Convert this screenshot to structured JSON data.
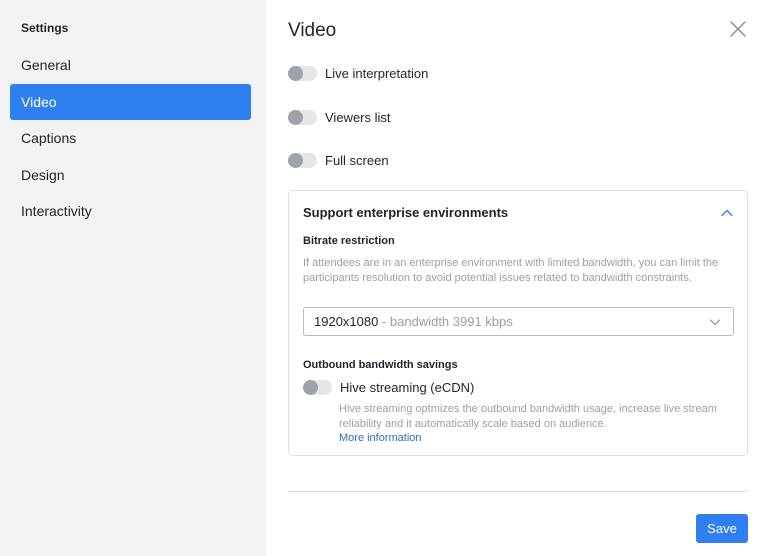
{
  "sidebar": {
    "title": "Settings",
    "items": [
      {
        "label": "General"
      },
      {
        "label": "Video"
      },
      {
        "label": "Captions"
      },
      {
        "label": "Design"
      },
      {
        "label": "Interactivity"
      }
    ],
    "active_item": "Video"
  },
  "main": {
    "title": "Video",
    "toggles": [
      {
        "label": "Live interpretation",
        "on": false
      },
      {
        "label": "Viewers list",
        "on": false
      },
      {
        "label": "Full screen",
        "on": false
      }
    ],
    "panel": {
      "title": "Support enterprise environments",
      "expanded": true,
      "bitrate": {
        "label": "Bitrate restriction",
        "help": "If attendees are in an enterprise environment with limited bandwidth, you can limit the participants resolution to avoid potential issues related to bandwidth constraints.",
        "selected_value": "1920x1080",
        "selected_sub": " - bandwidth 3991 kbps"
      },
      "outbound": {
        "label": "Outbound bandwidth savings",
        "toggle_label": "Hive streaming (eCDN)",
        "toggle_on": false,
        "help": "Hive streaming optmizes the outbound bandwidth usage, increase live stream reliability and it automatically scale based on audience.",
        "link": "More information"
      }
    },
    "save_label": "Save"
  },
  "colors": {
    "accent": "#2f7ff0",
    "sidebar_bg": "#f2f3f5",
    "link": "#2f6ec8",
    "muted_text": "#9aa0a8"
  },
  "icons": {
    "close": "close-icon",
    "panel_toggle": "chevron-up-icon",
    "select_toggle": "chevron-down-icon"
  }
}
